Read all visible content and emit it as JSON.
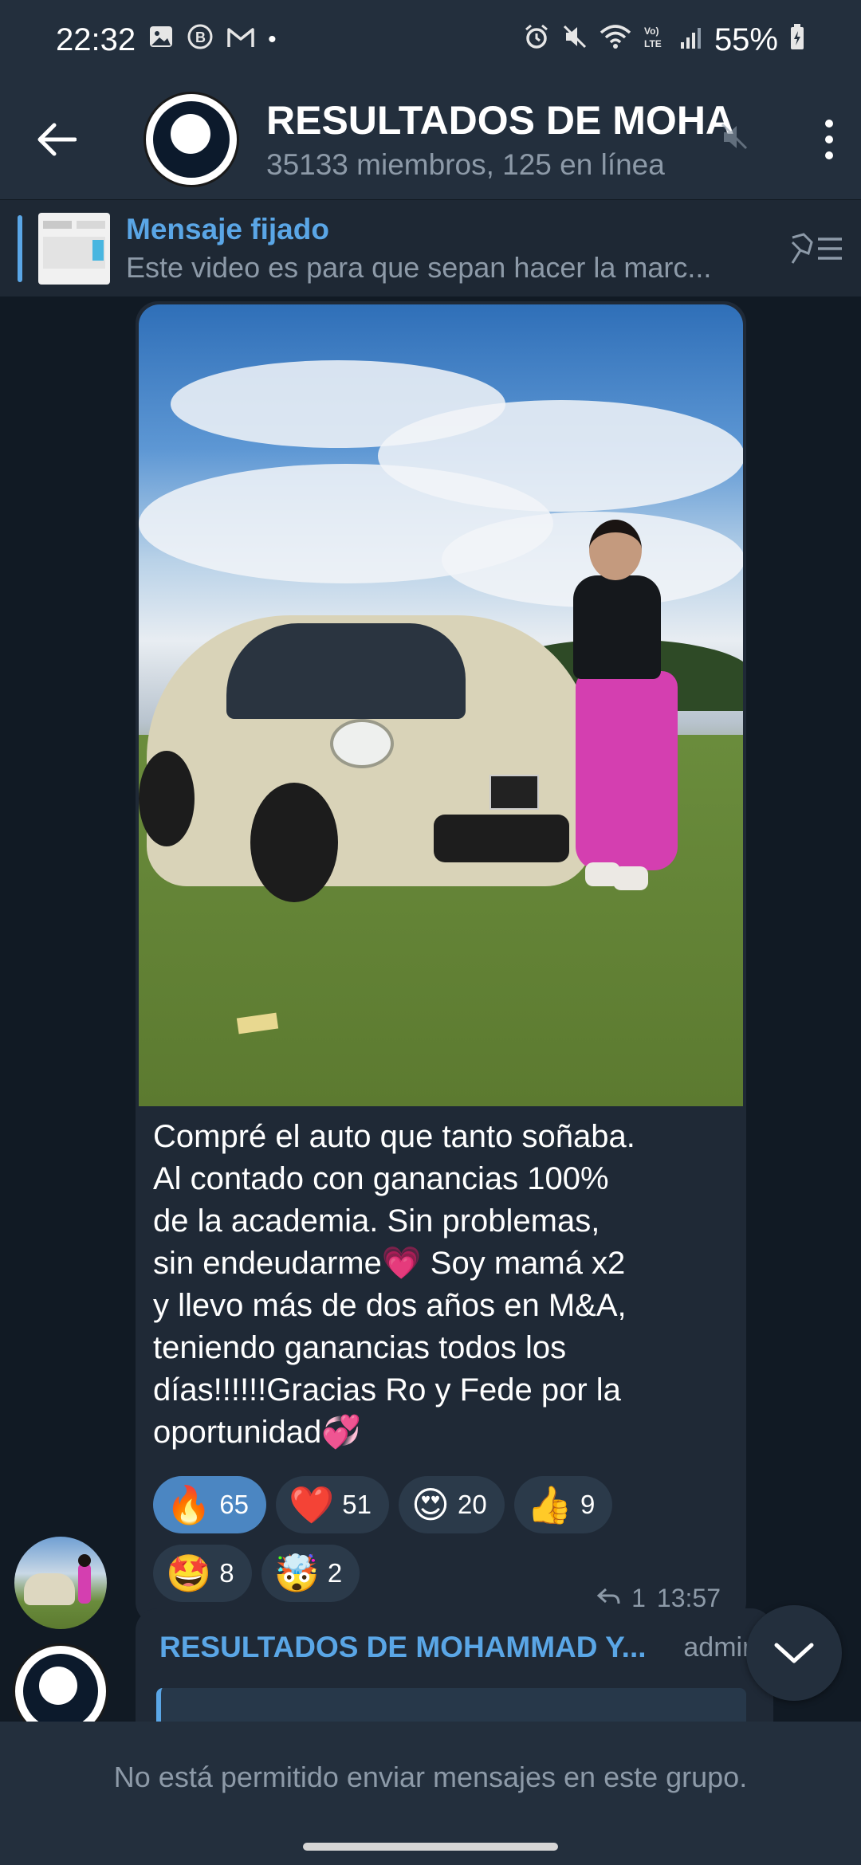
{
  "status_bar": {
    "time": "22:32",
    "battery": "55%",
    "left_icons": [
      "image-icon",
      "b-badge-icon",
      "gmail-icon",
      "dot-icon"
    ],
    "right_icons": [
      "alarm-icon",
      "mute-icon",
      "wifi-icon",
      "volte-icon",
      "signal-icon",
      "battery-icon"
    ]
  },
  "header": {
    "title": "RESULTADOS DE MOHAM",
    "subtitle": "35133 miembros, 125 en línea",
    "muted_icon": "speaker-muted-icon"
  },
  "pinned": {
    "label": "Mensaje fijado",
    "preview": "Este video es para que sepan hacer la marc..."
  },
  "message": {
    "text_lines": [
      "Compré el auto que tanto soñaba.",
      "Al contado con ganancias 100%",
      "de la academia. Sin problemas,",
      "sin endeudarme💗 Soy mamá x2",
      "y llevo más de dos años en M&A,",
      "teniendo ganancias todos los",
      "días!!!!!!Gracias Ro y Fede por la",
      "oportunidad💞"
    ],
    "reactions": [
      {
        "emoji": "🔥",
        "count": "65",
        "active": true
      },
      {
        "emoji": "❤️",
        "count": "51",
        "active": false
      },
      {
        "emoji": "😍",
        "count": "20",
        "active": false
      },
      {
        "emoji": "👍",
        "count": "9",
        "active": false
      },
      {
        "emoji": "🤩",
        "count": "8",
        "active": false
      },
      {
        "emoji": "🤯",
        "count": "2",
        "active": false
      }
    ],
    "replies": "1",
    "time": "13:57"
  },
  "next_message": {
    "sender": "RESULTADOS DE MOHAMMAD Y...",
    "role": "admin"
  },
  "bottom_notice": "No está permitido enviar mensajes en este grupo.",
  "colors": {
    "accent": "#5aa6e6",
    "header_bg": "#232f3d",
    "bubble_bg": "#1f2936",
    "chat_bg": "#111a24",
    "reaction_active": "#4b86c2"
  }
}
